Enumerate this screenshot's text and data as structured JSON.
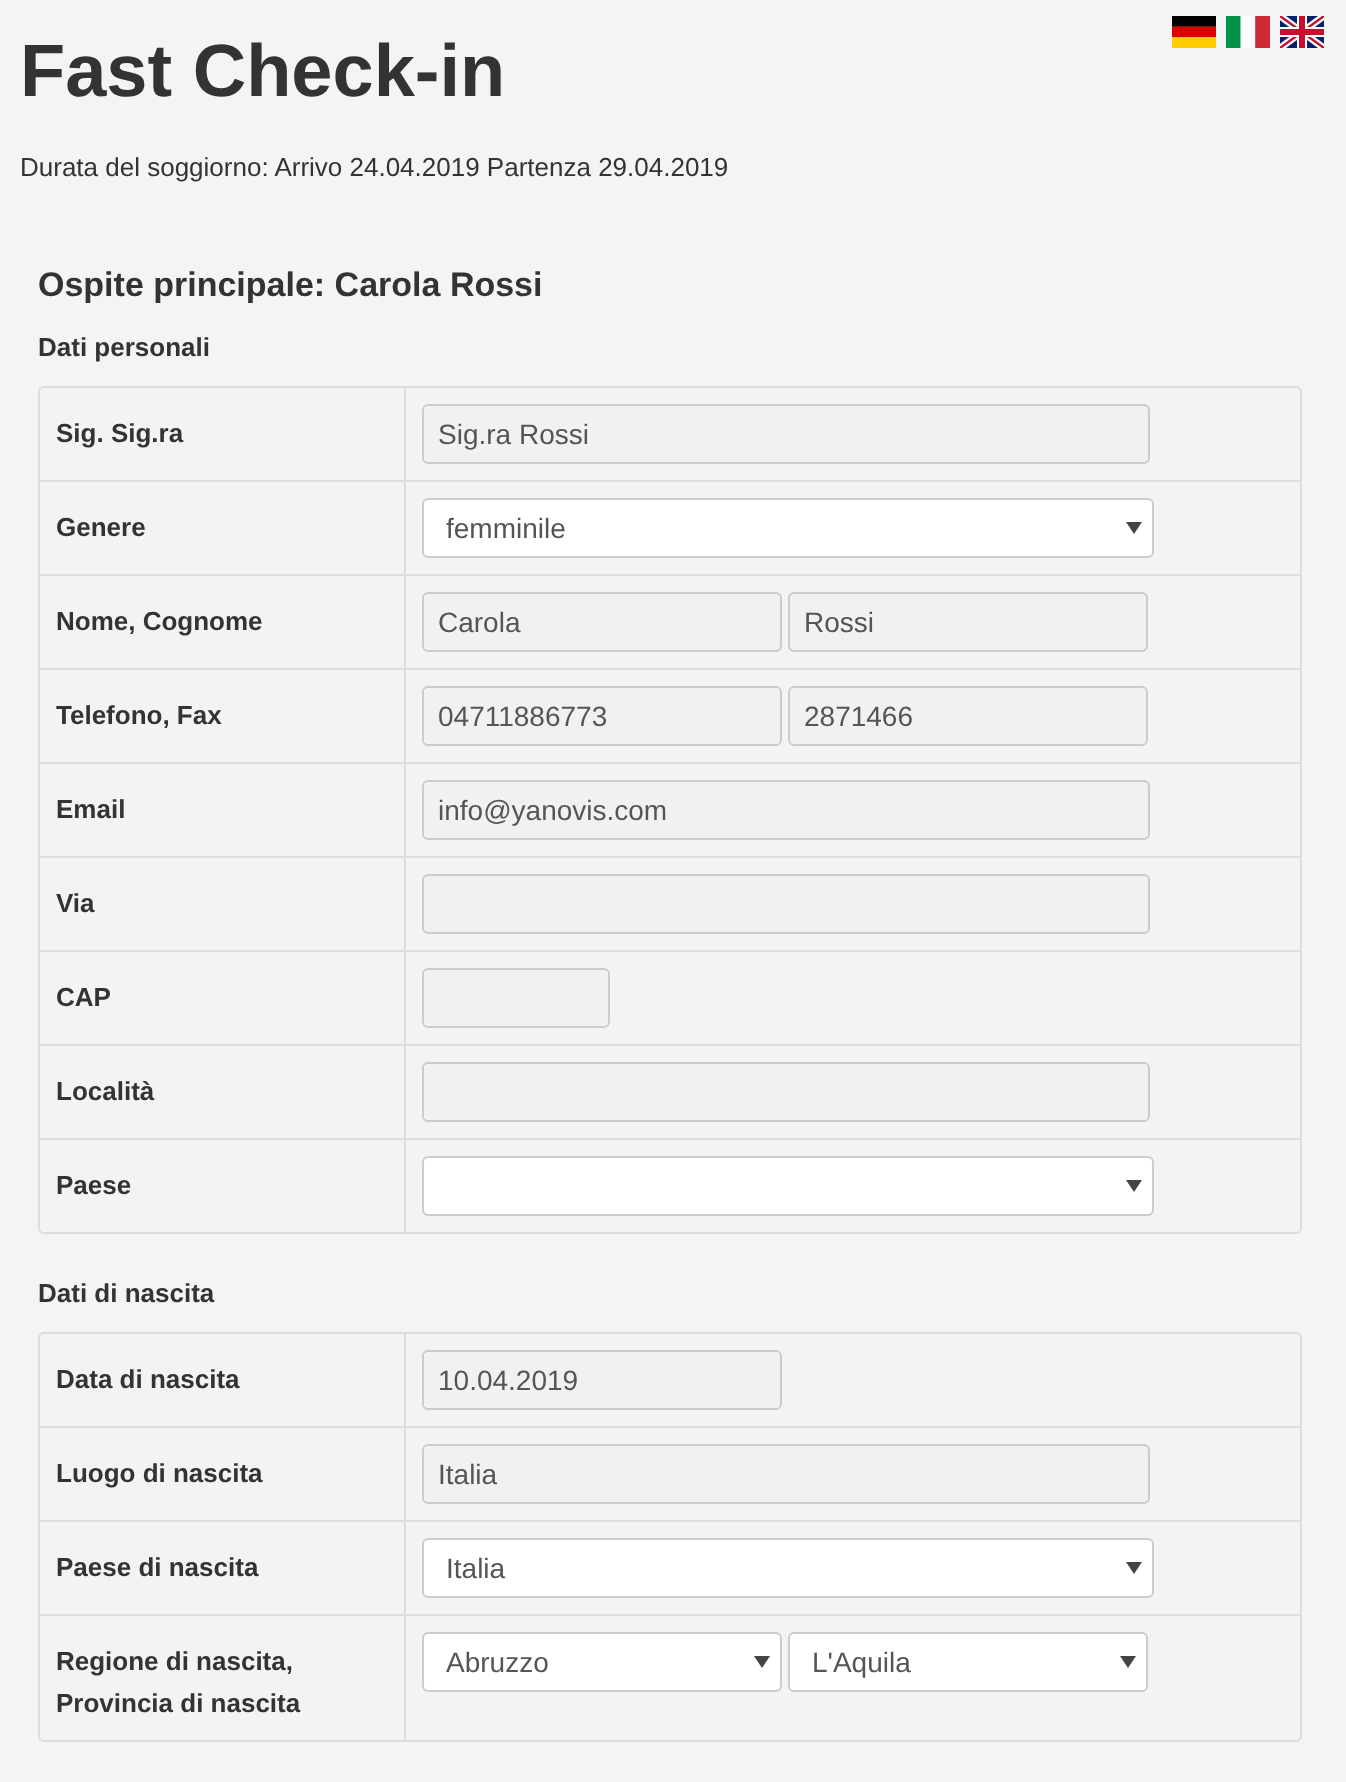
{
  "title": "Fast Check-in",
  "languages": [
    {
      "kind": "de"
    },
    {
      "kind": "it"
    },
    {
      "kind": "gb"
    }
  ],
  "stay": "Durata del soggiorno: Arrivo 24.04.2019 Partenza 29.04.2019",
  "guest_heading": "Ospite principale: Carola Rossi",
  "sections": [
    {
      "title": "Dati personali",
      "rows": [
        {
          "label": "Sig. Sig.ra",
          "fields": [
            {
              "kind": "text",
              "value": "Sig.ra Rossi"
            }
          ]
        },
        {
          "label": "Genere",
          "fields": [
            {
              "kind": "select",
              "value": "femminile"
            }
          ]
        },
        {
          "label": "Nome, Cognome",
          "fields": [
            {
              "kind": "text",
              "value": "Carola"
            },
            {
              "kind": "text",
              "value": "Rossi"
            }
          ]
        },
        {
          "label": "Telefono, Fax",
          "fields": [
            {
              "kind": "text",
              "value": "04711886773"
            },
            {
              "kind": "text",
              "value": "2871466"
            }
          ]
        },
        {
          "label": "Email",
          "fields": [
            {
              "kind": "text",
              "value": "info@yanovis.com"
            }
          ]
        },
        {
          "label": "Via",
          "fields": [
            {
              "kind": "text"
            }
          ]
        },
        {
          "label": "CAP",
          "fields": [
            {
              "kind": "zip"
            }
          ]
        },
        {
          "label": "Località",
          "fields": [
            {
              "kind": "text"
            }
          ]
        },
        {
          "label": "Paese",
          "fields": [
            {
              "kind": "select"
            }
          ]
        }
      ]
    },
    {
      "title": "Dati di nascita",
      "rows": [
        {
          "label": "Data di nascita",
          "fields": [
            {
              "kind": "date",
              "value": "10.04.2019"
            }
          ]
        },
        {
          "label": "Luogo di nascita",
          "fields": [
            {
              "kind": "text",
              "value": "Italia"
            }
          ]
        },
        {
          "label": "Paese di nascita",
          "fields": [
            {
              "kind": "select",
              "value": "Italia"
            }
          ]
        },
        {
          "label": "Regione di nascita, Provincia di nascita",
          "fields": [
            {
              "kind": "select",
              "value": "Abruzzo"
            },
            {
              "kind": "select",
              "value": "L'Aquila"
            }
          ]
        }
      ]
    }
  ]
}
